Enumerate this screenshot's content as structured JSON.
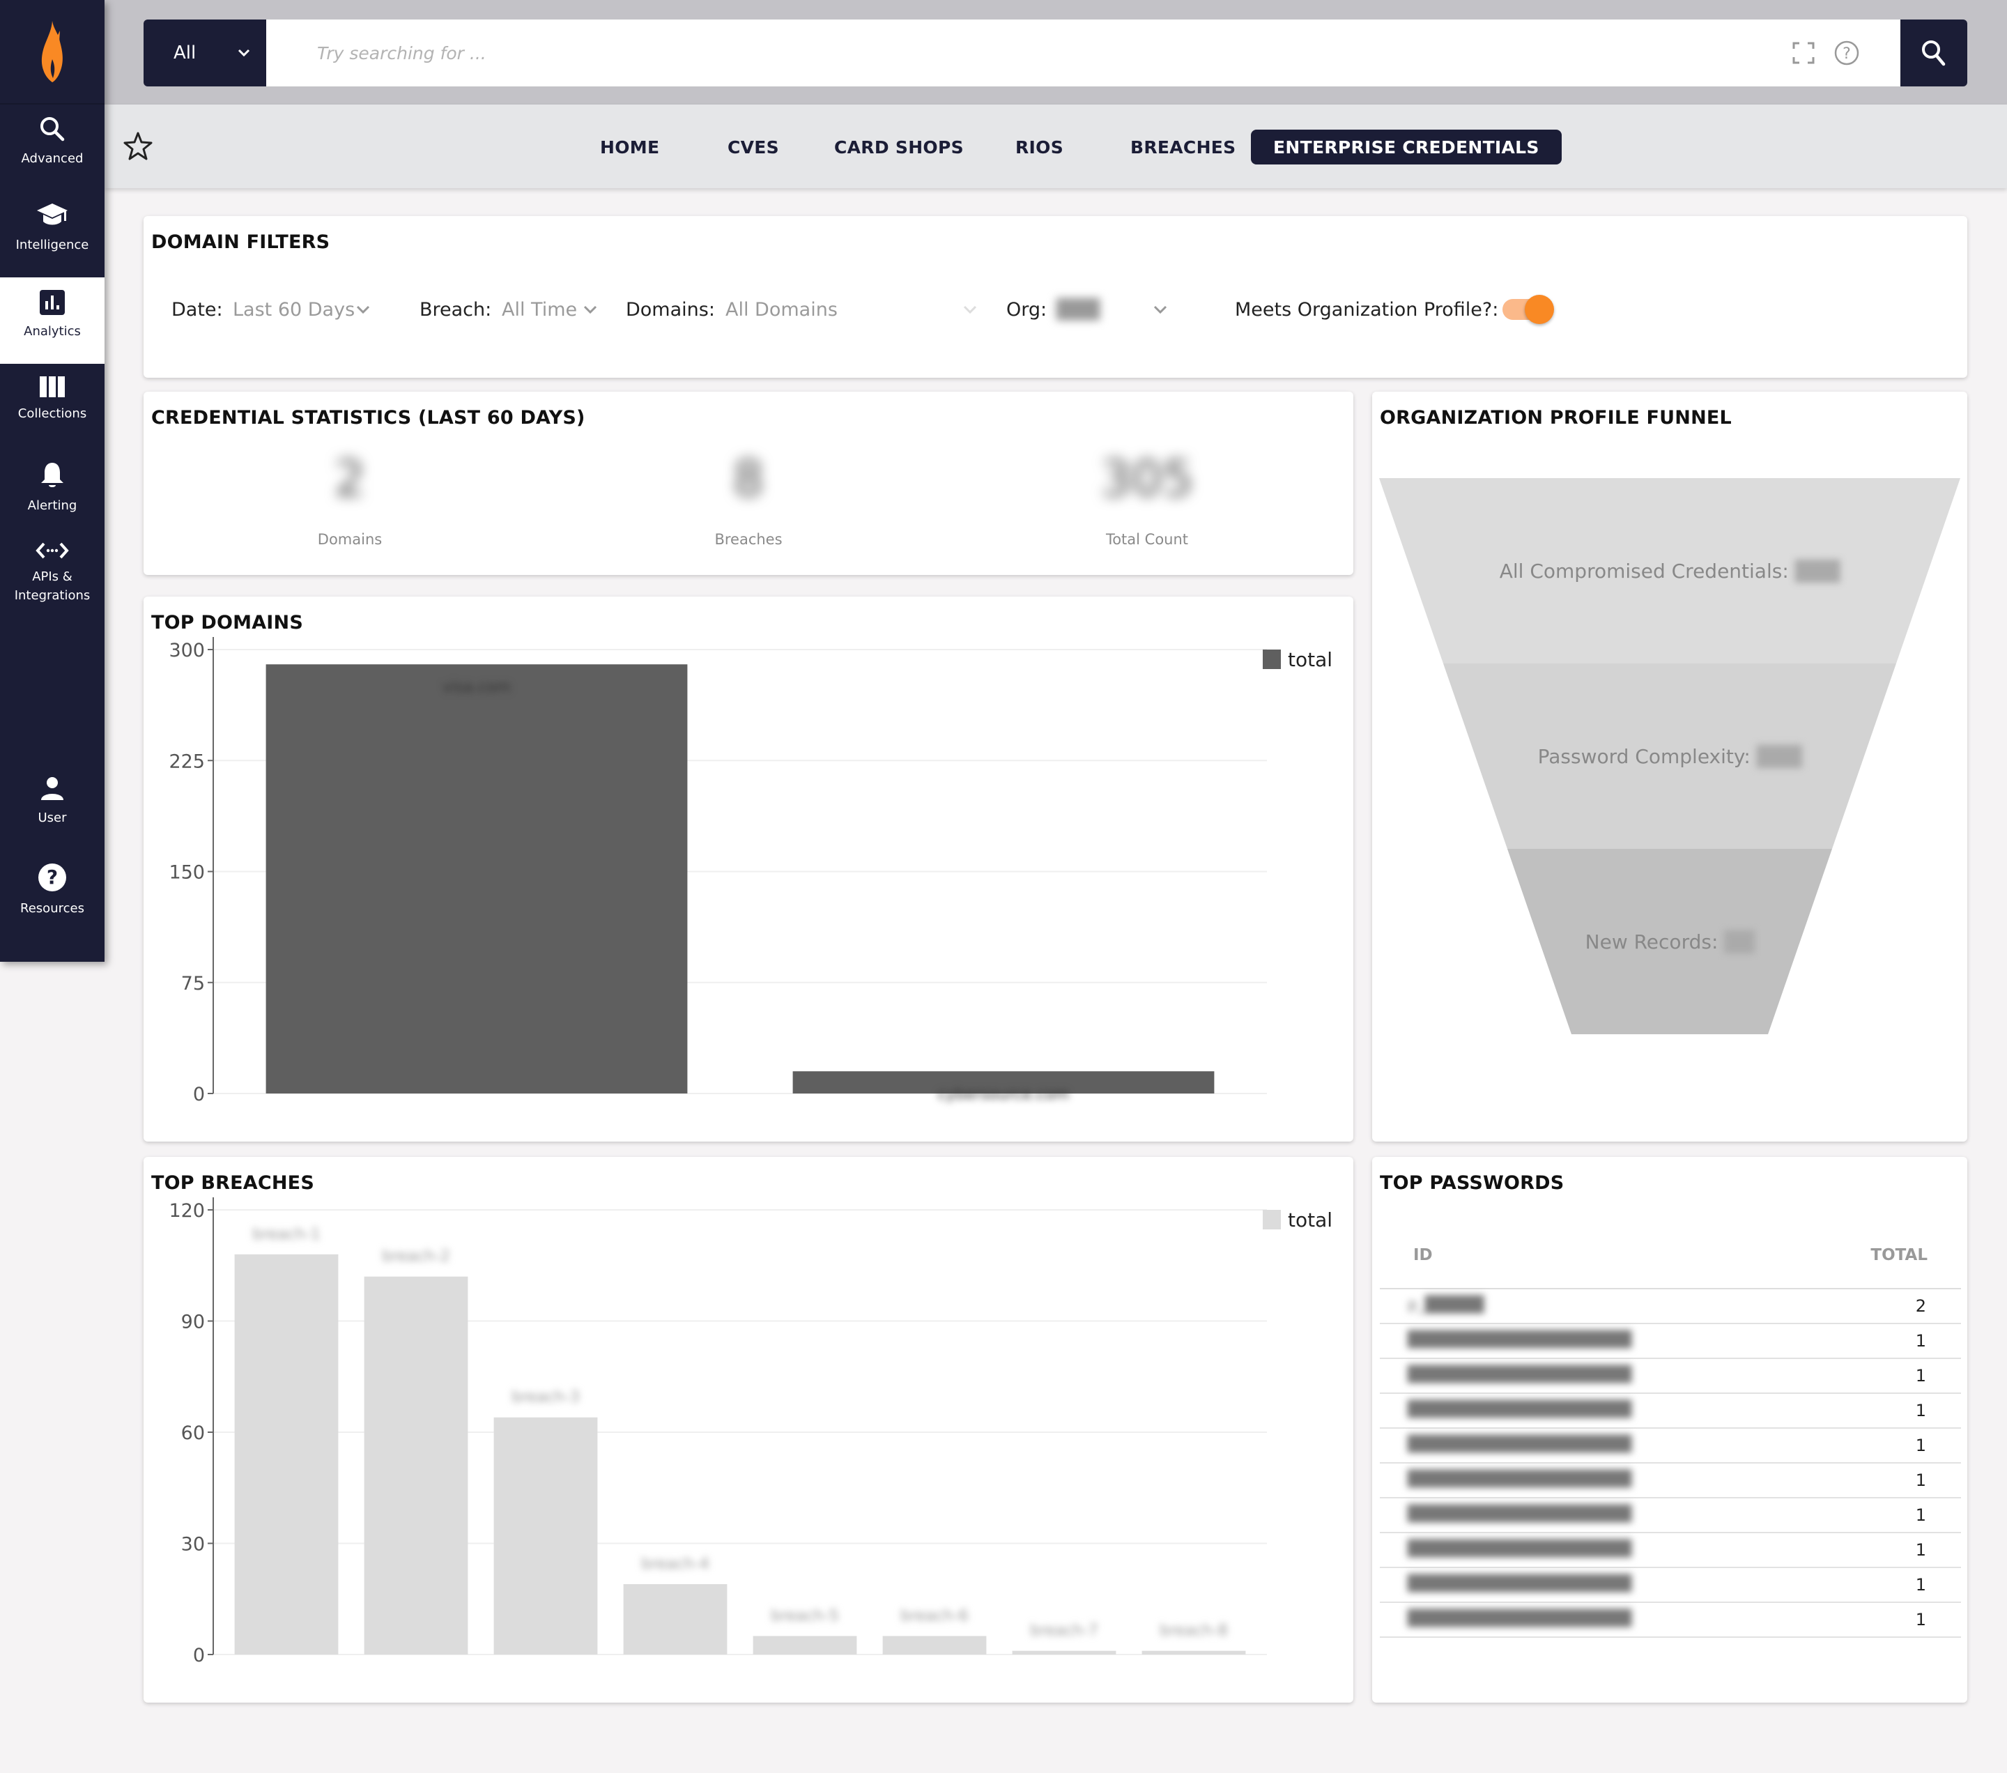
{
  "sidebar": {
    "logo": "flame-logo",
    "items": [
      {
        "label": "Advanced",
        "icon": "search-icon"
      },
      {
        "label": "Intelligence",
        "icon": "graduation-cap-icon"
      },
      {
        "label": "Analytics",
        "icon": "bar-chart-icon",
        "active": true
      },
      {
        "label": "Collections",
        "icon": "columns-icon"
      },
      {
        "label": "Alerting",
        "icon": "bell-icon"
      },
      {
        "label": "APIs &",
        "label2": "Integrations",
        "icon": "code-arrows-icon"
      },
      {
        "label": "User",
        "icon": "user-icon"
      },
      {
        "label": "Resources",
        "icon": "help-circle-icon"
      }
    ]
  },
  "search": {
    "scope": "All",
    "placeholder": "Try searching for ...",
    "value": ""
  },
  "nav": {
    "tabs": [
      "HOME",
      "CVES",
      "CARD SHOPS",
      "RIOS",
      "BREACHES",
      "ENTERPRISE CREDENTIALS"
    ],
    "active": "ENTERPRISE CREDENTIALS"
  },
  "filters": {
    "title": "DOMAIN FILTERS",
    "date_label": "Date:",
    "date_value": "Last 60 Days",
    "breach_label": "Breach:",
    "breach_value": "All Time",
    "domains_label": "Domains:",
    "domains_value": "All Domains",
    "org_label": "Org:",
    "org_value": "███",
    "profile_label": "Meets Organization Profile?:",
    "profile_on": true
  },
  "stats": {
    "title": "CREDENTIAL STATISTICS (LAST 60 DAYS)",
    "items": [
      {
        "label": "Domains",
        "value": "2"
      },
      {
        "label": "Breaches",
        "value": "8"
      },
      {
        "label": "Total Count",
        "value": "305"
      }
    ]
  },
  "funnel": {
    "title": "ORGANIZATION PROFILE FUNNEL",
    "stages": [
      {
        "label": "All Compromised Credentials:",
        "value": "███",
        "color": "#dcdcdc"
      },
      {
        "label": "Password Complexity:",
        "value": "███",
        "color": "#d3d3d3"
      },
      {
        "label": "New Records:",
        "value": "██",
        "color": "#c0c0c0"
      }
    ]
  },
  "passwords": {
    "title": "TOP PASSWORDS",
    "col_id": "ID",
    "col_total": "TOTAL",
    "rows": [
      {
        "id": "p_█████",
        "total": "2"
      },
      {
        "id": "███████████████████",
        "total": "1"
      },
      {
        "id": "███████████████████",
        "total": "1"
      },
      {
        "id": "███████████████████",
        "total": "1"
      },
      {
        "id": "███████████████████",
        "total": "1"
      },
      {
        "id": "███████████████████",
        "total": "1"
      },
      {
        "id": "███████████████████",
        "total": "1"
      },
      {
        "id": "███████████████████",
        "total": "1"
      },
      {
        "id": "███████████████████",
        "total": "1"
      },
      {
        "id": "███████████████████",
        "total": "1"
      }
    ]
  },
  "colors": {
    "navy": "#1b1d36",
    "accent": "#f98924",
    "domains_bar": "#5f5f5f",
    "breaches_bar": "#dcdcdc"
  },
  "chart_data": [
    {
      "type": "bar",
      "title": "TOP DOMAINS",
      "categories": [
        "visa.com",
        "cybersource.com"
      ],
      "categories_redacted": true,
      "series": [
        {
          "name": "total",
          "values": [
            290,
            15
          ],
          "color": "#5f5f5f"
        }
      ],
      "yticks": [
        0,
        75,
        150,
        225,
        300
      ],
      "ylim": [
        0,
        300
      ],
      "xlabel": "",
      "ylabel": "",
      "grid": true,
      "legend": "top-right"
    },
    {
      "type": "bar",
      "title": "TOP BREACHES",
      "categories": [
        "breach-1",
        "breach-2",
        "breach-3",
        "breach-4",
        "breach-5",
        "breach-6",
        "breach-7",
        "breach-8"
      ],
      "categories_redacted": true,
      "series": [
        {
          "name": "total",
          "values": [
            108,
            102,
            64,
            19,
            5,
            5,
            1,
            1
          ],
          "color": "#dcdcdc"
        }
      ],
      "yticks": [
        0,
        30,
        60,
        90,
        120
      ],
      "ylim": [
        0,
        120
      ],
      "xlabel": "",
      "ylabel": "",
      "grid": true,
      "legend": "top-right"
    }
  ]
}
